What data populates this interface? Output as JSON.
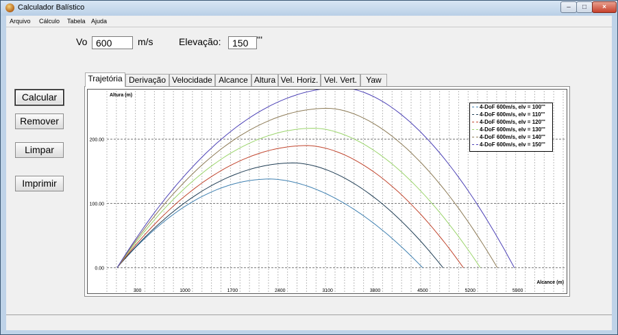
{
  "window": {
    "title": "Calculador Balístico",
    "min": "–",
    "max": "□",
    "close": "×"
  },
  "menu": [
    "Arquivo",
    "Cálculo",
    "Tabela",
    "Ajuda"
  ],
  "inputs": {
    "vo_label": "Vo",
    "vo_value": "600",
    "vo_unit": "m/s",
    "elev_label": "Elevação:",
    "elev_value": "150",
    "elev_unit": "'''"
  },
  "buttons": {
    "calcular": "Calcular",
    "remover": "Remover",
    "limpar": "Limpar",
    "imprimir": "Imprimir"
  },
  "tabs": [
    "Trajetória",
    "Derivação",
    "Velocidade",
    "Alcance",
    "Altura",
    "Vel. Horiz.",
    "Vel. Vert.",
    "Yaw"
  ],
  "chart_data": {
    "type": "line",
    "ylabel": "Altura (m)",
    "xlabel": "Alcance (m)",
    "x_ticks": [
      300,
      1000,
      1700,
      2400,
      3100,
      3800,
      4500,
      5200,
      5900
    ],
    "y_ticks": [
      "0.00",
      "100.00",
      "200.00"
    ],
    "xlim": [
      -150,
      6600
    ],
    "ylim": [
      -10,
      275
    ],
    "grid": true,
    "legend_position": "top-right",
    "series": [
      {
        "name": "4-DoF 600m/s,  elv = 100'''",
        "color": "#3d7fb0",
        "apex": [
          2250,
          138
        ],
        "range": 4500
      },
      {
        "name": "4-DoF 600m/s,  elv = 110'''",
        "color": "#1d3b52",
        "apex": [
          2600,
          163
        ],
        "range": 4800
      },
      {
        "name": "4-DoF 600m/s,  elv = 120'''",
        "color": "#c0432b",
        "apex": [
          2800,
          190
        ],
        "range": 5100
      },
      {
        "name": "4-DoF 600m/s,  elv = 130'''",
        "color": "#9ad46a",
        "apex": [
          2900,
          217
        ],
        "range": 5350
      },
      {
        "name": "4-DoF 600m/s,  elv = 140'''",
        "color": "#8c7a55",
        "apex": [
          3100,
          248
        ],
        "range": 5600
      },
      {
        "name": "4-DoF 600m/s,  elv = 150'''",
        "color": "#4a3fb5",
        "apex": [
          3300,
          280
        ],
        "range": 5850
      }
    ]
  }
}
